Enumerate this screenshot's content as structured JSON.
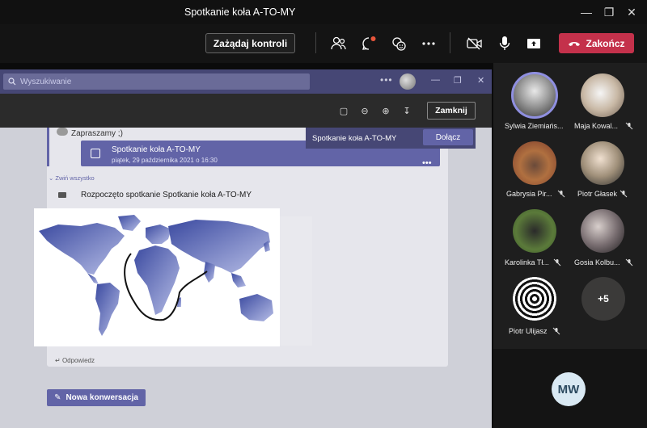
{
  "window": {
    "title": "Spotkanie koła A-TO-MY"
  },
  "meeting_bar": {
    "request_control": "Zażądaj kontroli",
    "end_call": "Zakończ"
  },
  "shared_screen": {
    "search_placeholder": "Wyszukiwanie",
    "close_viewer": "Zamknij",
    "welcome": "Zapraszamy ;)",
    "event_title": "Spotkanie koła A-TO-MY",
    "event_date": "piątek, 29 października 2021 o 16:30",
    "popup_text": "Spotkanie koła A-TO-MY",
    "join": "Dołącz",
    "collapse_all": "Zwiń wszystko",
    "meeting_started": "Rozpoczęto spotkanie Spotkanie koła A-TO-MY",
    "reply": "Odpowiedz",
    "new_conversation": "Nowa konwersacja"
  },
  "participants": [
    {
      "name": "Sylwia Ziemiańs...",
      "muted": false,
      "active": true
    },
    {
      "name": "Maja Kowal...",
      "muted": true
    },
    {
      "name": "Gabrysia Pir...",
      "muted": true
    },
    {
      "name": "Piotr Głasek",
      "muted": true
    },
    {
      "name": "Karolinka Tł...",
      "muted": true
    },
    {
      "name": "Gosia Kolbu...",
      "muted": true
    },
    {
      "name": "Piotr Ulijasz",
      "muted": true
    }
  ],
  "more_participants": "+5",
  "self_initials": "MW",
  "colors": {
    "accent": "#6264a7",
    "end_call": "#c4314b",
    "active_ring": "#8f8fe0"
  }
}
